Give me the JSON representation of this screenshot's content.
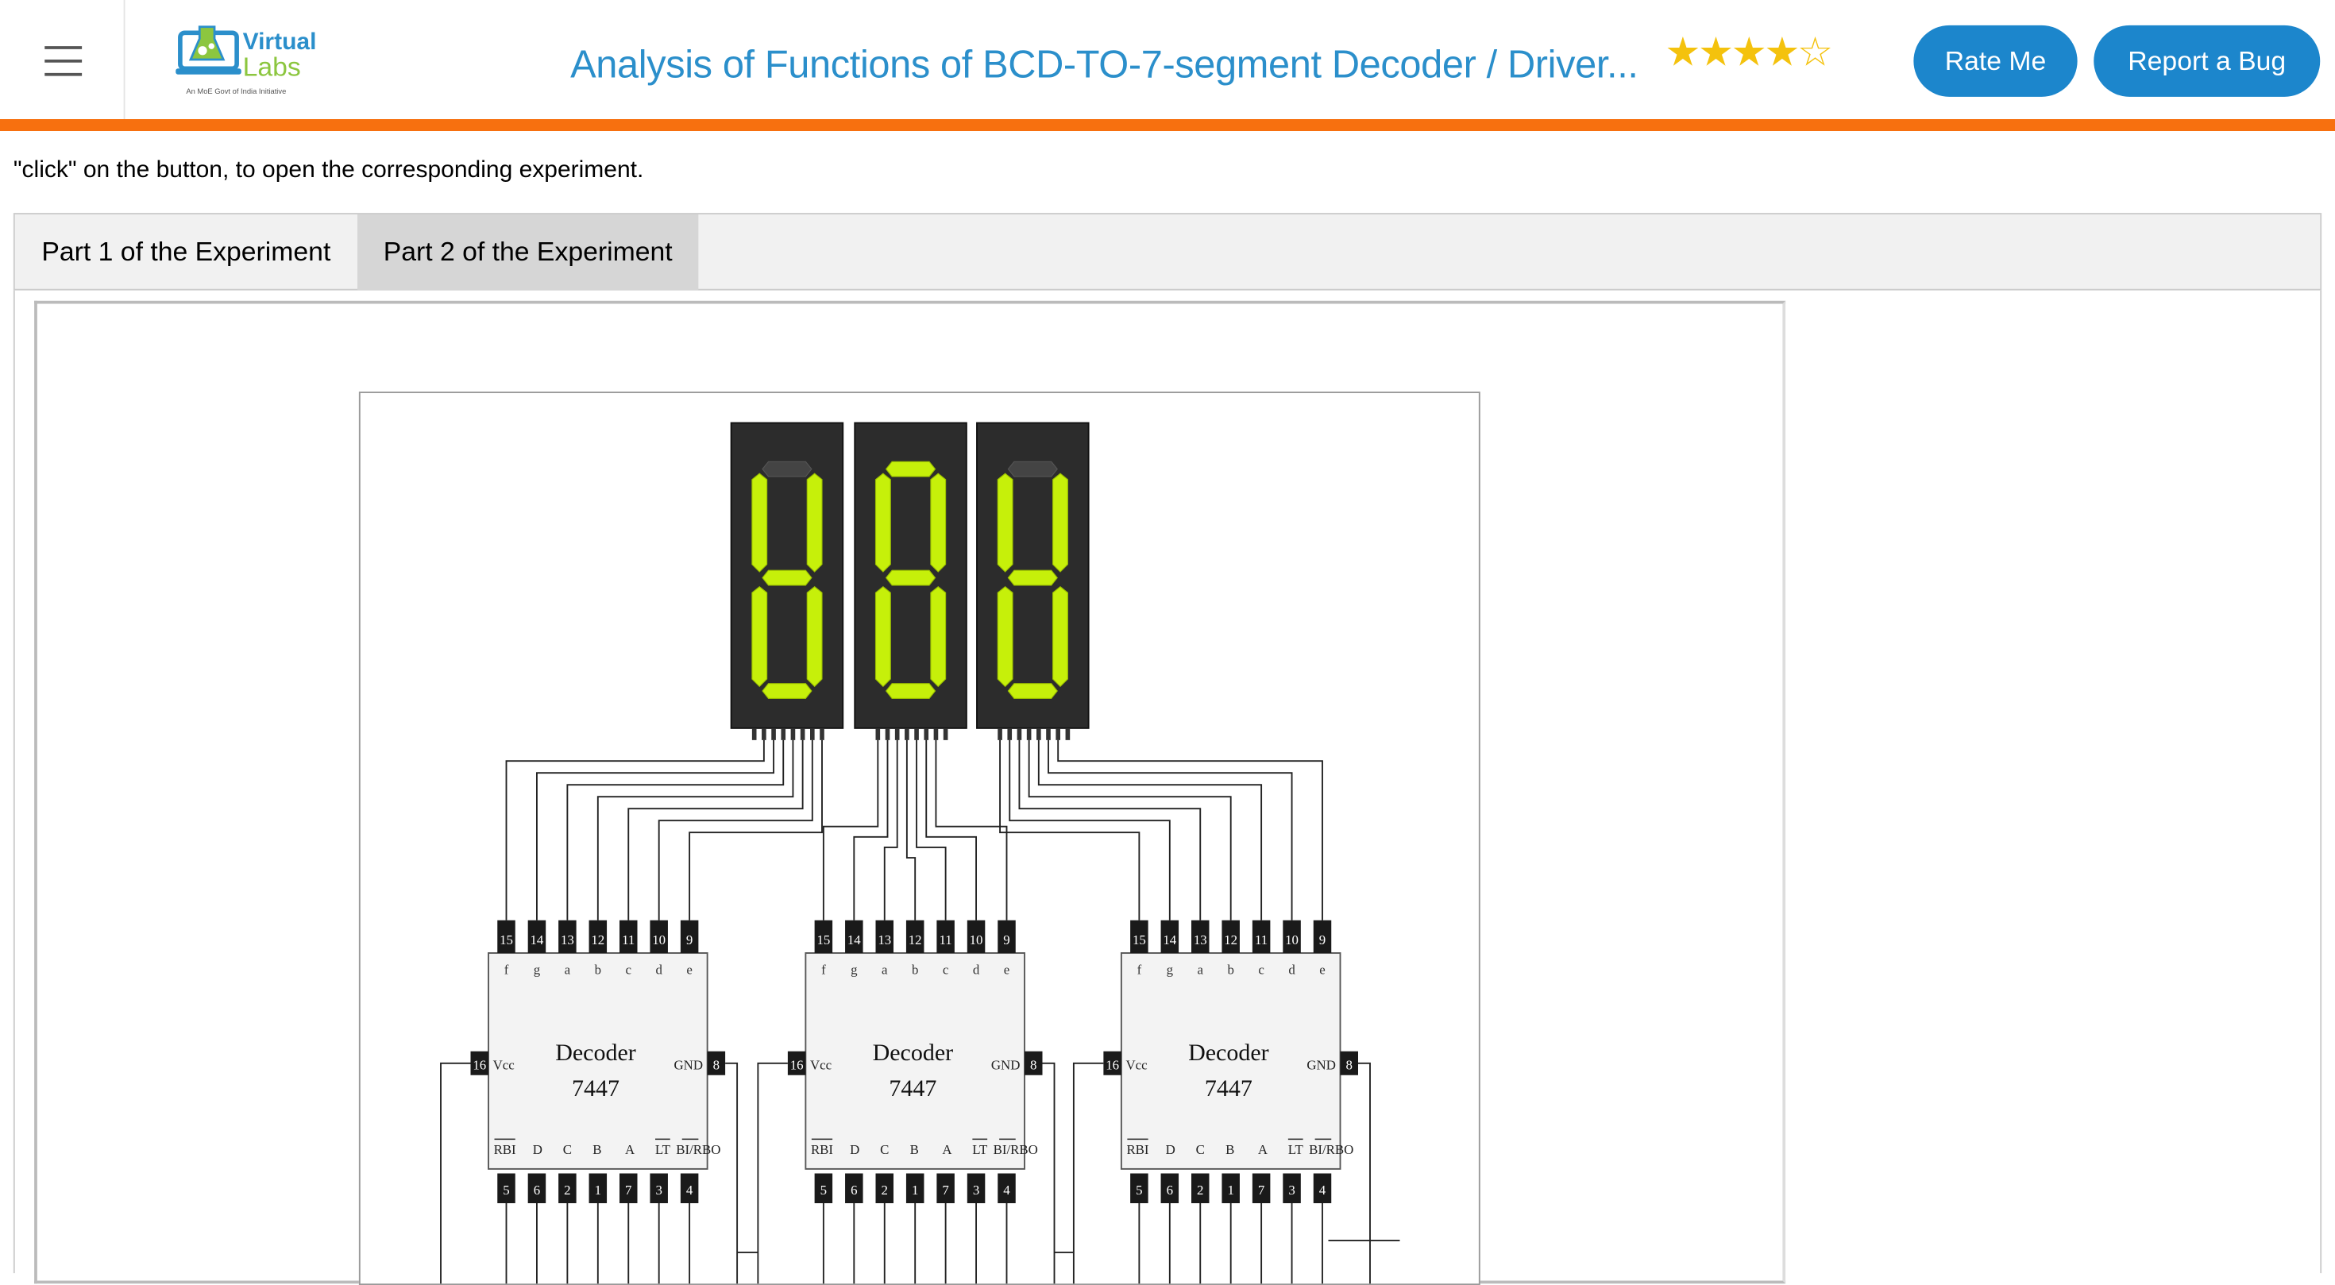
{
  "header": {
    "logo_top": "Virtual",
    "logo_bottom": "Labs",
    "logo_tagline": "An MoE Govt of India Initiative",
    "title": "Analysis of Functions of BCD-TO-7-segment Decoder / Driver...",
    "rating": 4,
    "rating_max": 5,
    "rate_button": "Rate Me",
    "bug_button": "Report a Bug"
  },
  "colors": {
    "accent": "#2b8fcb",
    "button": "#1c86cc",
    "rule": "#f7700f",
    "segment_on": "#c6f00a",
    "segment_off": "#444444"
  },
  "instruction": "\"click\" on the button, to open the corresponding experiment.",
  "tabs": [
    {
      "label": "Part 1 of the Experiment",
      "active": false
    },
    {
      "label": "Part 2 of the Experiment",
      "active": true
    }
  ],
  "circuit": {
    "displays": [
      {
        "digit": "8",
        "segments_on": [
          "b",
          "c",
          "d",
          "e",
          "f",
          "g"
        ]
      },
      {
        "digit": "8",
        "segments_on": [
          "a",
          "b",
          "c",
          "d",
          "e",
          "f",
          "g"
        ]
      },
      {
        "digit": "8",
        "segments_on": [
          "b",
          "c",
          "d",
          "e",
          "f",
          "g"
        ]
      }
    ],
    "decoders": [
      {
        "name": "Decoder",
        "part": "7447"
      },
      {
        "name": "Decoder",
        "part": "7447"
      },
      {
        "name": "Decoder",
        "part": "7447"
      }
    ],
    "top_pins": [
      "15",
      "14",
      "13",
      "12",
      "11",
      "10",
      "9"
    ],
    "top_pin_labels": [
      "f",
      "g",
      "a",
      "b",
      "c",
      "d",
      "e"
    ],
    "bottom_pins": [
      "5",
      "6",
      "2",
      "1",
      "7",
      "3",
      "4"
    ],
    "bottom_pin_labels": [
      "RBI",
      "D",
      "C",
      "B",
      "A",
      "LT",
      "BI/RBO"
    ],
    "vcc_pin": "16",
    "vcc_label": "Vcc",
    "gnd_pin": "8",
    "gnd_label": "GND"
  }
}
